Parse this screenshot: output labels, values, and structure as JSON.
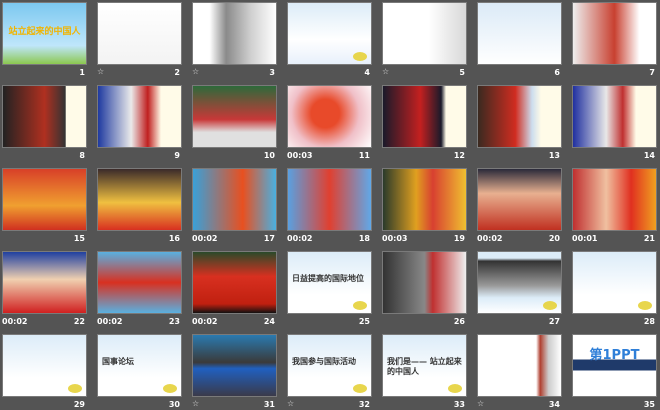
{
  "view": "slide-sorter",
  "slides": [
    {
      "n": "1",
      "bg": "linear-gradient(#7cc8f0,#bfe6fa 70%,#8cc850)",
      "title": "站立起来的中国人",
      "style": "big"
    },
    {
      "n": "2",
      "bg": "linear-gradient(#fff,#f3f3f3)",
      "icon": "star"
    },
    {
      "n": "3",
      "bg": "linear-gradient(90deg,#fff 20%,#8a8a8a 40%,#d0d0d0 70%,#fff)",
      "icon": "star"
    },
    {
      "n": "4",
      "bg": "linear-gradient(#dcecf8,#fff 60%,#e8f0fb)"
    },
    {
      "n": "5",
      "bg": "linear-gradient(90deg,#fff 55%,#d8d8d8)",
      "icon": "star"
    },
    {
      "n": "6",
      "bg": "linear-gradient(#dbeaf7,#fff)"
    },
    {
      "n": "7",
      "bg": "linear-gradient(90deg,#eee,#c84030 50%,#fff 80%)"
    },
    {
      "n": "8",
      "bg": "linear-gradient(90deg,#222,#b03020 50%,#333 75%,#fffbe8 76%)"
    },
    {
      "n": "9",
      "bg": "linear-gradient(90deg,#1f3aa0,#eaeaea 40%,#c02020 60%,#fffbe8 76%)"
    },
    {
      "n": "10",
      "bg": "linear-gradient(#2d6a3a,#c83838 55%,#e0e0e0 76%)"
    },
    {
      "n": "11",
      "bg": "radial-gradient(circle at 45% 45%,#e84a2a 25%,#f0c0c8 60%,#fff)",
      "time": "00:03"
    },
    {
      "n": "12",
      "bg": "linear-gradient(90deg,#1a1a2a,#c42020 45%,#1a1a2a 70%,#fffbe8 76%)"
    },
    {
      "n": "13",
      "bg": "linear-gradient(90deg,#3a2a20,#d02c20 45%,#cde 65%,#fffbe8 76%)"
    },
    {
      "n": "14",
      "bg": "linear-gradient(90deg,#2030a0,#e8e8e8 40%,#c03030 60%,#fffbe8 76%)"
    },
    {
      "n": "15",
      "bg": "linear-gradient(#d84028,#f0a030 60%,#d03020)"
    },
    {
      "n": "16",
      "bg": "linear-gradient(#3a2a2a,#f0c040 55%,#d83020)"
    },
    {
      "n": "17",
      "bg": "linear-gradient(90deg,#3aa0d8,#e85020 60%,#4ab0e0)",
      "time": "00:02"
    },
    {
      "n": "18",
      "bg": "linear-gradient(90deg,#5aa0e0,#e04030 50%,#60a8e8)",
      "time": "00:02"
    },
    {
      "n": "19",
      "bg": "linear-gradient(90deg,#2a3a2a,#e0a020 40%,#d84030 60%,#f0c030)",
      "time": "00:03"
    },
    {
      "n": "20",
      "bg": "linear-gradient(#2a2a3a,#e8b090 40%,#c03020)",
      "time": "00:02"
    },
    {
      "n": "21",
      "bg": "linear-gradient(90deg,#c03030,#f0c0a0 40%,#e03020 70%,#f0a020)",
      "time": "00:01"
    },
    {
      "n": "22",
      "bg": "linear-gradient(#2040a0,#f0d0b0 45%,#d02020)",
      "time": "00:02"
    },
    {
      "n": "23",
      "bg": "linear-gradient(#5ab0e0,#d83020 50%,#5ab0e0)",
      "time": "00:02"
    },
    {
      "n": "24",
      "bg": "linear-gradient(#2a4a2a,#d83020 40%,#c02010 85%,#111)",
      "time": "00:02"
    },
    {
      "n": "25",
      "bg": "linear-gradient(#dcecf8,#fff 70%)",
      "title": "日益提高的国际地位"
    },
    {
      "n": "26",
      "bg": "linear-gradient(90deg,#333,#888 50%,#c03030 60%,#eee)"
    },
    {
      "n": "27",
      "bg": "linear-gradient(#dcecf8 10%,#333 15%,#999 55%,#dcecf8 75%,#fff)"
    },
    {
      "n": "28",
      "bg": "linear-gradient(#dcecf8,#fff 70%)"
    },
    {
      "n": "29",
      "bg": "linear-gradient(#dcecf8,#fff 70%)"
    },
    {
      "n": "30",
      "bg": "linear-gradient(#dcecf8,#fff 70%)",
      "title": "国事论坛"
    },
    {
      "n": "31",
      "bg": "linear-gradient(#2a7ab0,#3a3a3a 45%,#2060c0 55%,#3a3a4a)",
      "icon": "star"
    },
    {
      "n": "32",
      "bg": "linear-gradient(#dcecf8,#fff 70%)",
      "title": "我国参与国际活动",
      "icon": "star"
    },
    {
      "n": "33",
      "bg": "linear-gradient(#dcecf8,#fff 70%)",
      "title": "我们是—— 站立起来的中国人"
    },
    {
      "n": "34",
      "bg": "linear-gradient(90deg,#fff 70%,#b04030 75%,#ccc 85%,#fff)",
      "icon": "star"
    },
    {
      "n": "35",
      "bg": "linear-gradient(#fff 40%,#1f3a6a 40%,#1f3a6a 58%,#fff 58%)",
      "title": "第1PPT",
      "style": "blue"
    }
  ]
}
